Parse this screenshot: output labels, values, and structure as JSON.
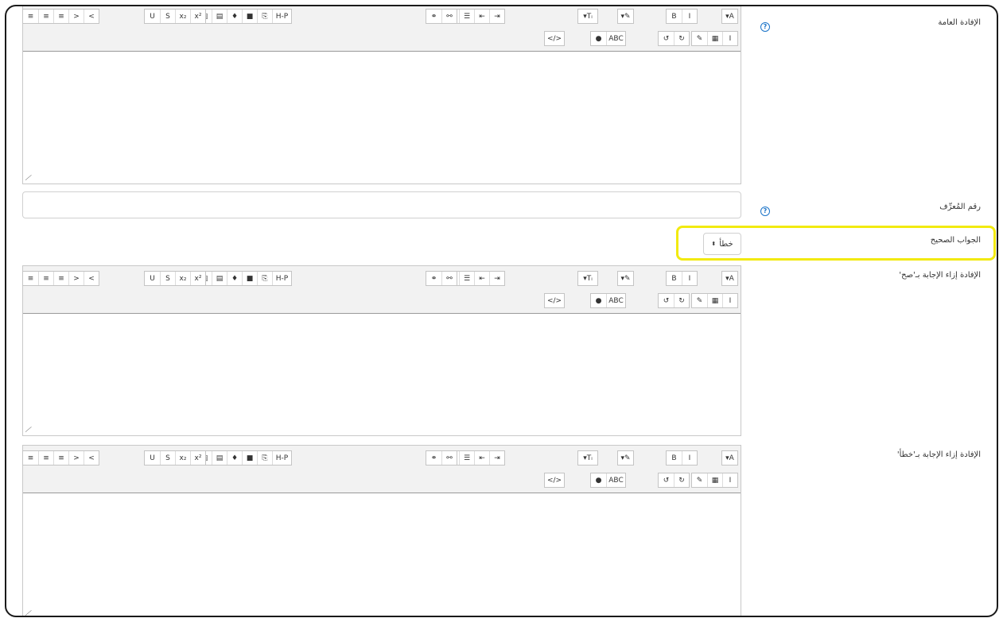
{
  "fields": {
    "general_feedback_label": "الإفادة العامة",
    "id_number_label": "رقم المُعرِّف",
    "correct_answer_label": "الجواب الصحيح",
    "feedback_true_label": "الإفادة إزاء الإجابة بـ'صح'",
    "feedback_false_label": "الإفادة إزاء الإجابة بـ'خطأ'"
  },
  "correct_answer": {
    "selected": "خطأ",
    "arrow": "⬍"
  },
  "help_icon_glyph": "?",
  "toolbar": {
    "row1": [
      {
        "name": "font-color",
        "items": [
          "▾A"
        ]
      },
      {
        "name": "format",
        "items": [
          "B",
          "I"
        ]
      },
      {
        "name": "highlight",
        "items": [
          "▾✎"
        ]
      },
      {
        "name": "font-size",
        "items": [
          "▾Tᵢ"
        ]
      },
      {
        "name": "lists",
        "items": [
          "☷",
          "☰",
          "⇤",
          "⇥"
        ]
      },
      {
        "name": "links",
        "items": [
          "⚭",
          "⚯"
        ]
      },
      {
        "name": "media",
        "items": [
          "☺",
          "▣",
          "▤",
          "♦",
          "■",
          "⎘",
          "H-P"
        ]
      },
      {
        "name": "text-style",
        "items": [
          "U",
          "S",
          "x₂",
          "x²"
        ]
      },
      {
        "name": "align",
        "items": [
          "≡",
          "≡",
          "≡",
          ">",
          "<"
        ]
      }
    ],
    "row2": [
      {
        "name": "edit",
        "items": [
          "✎",
          "▦",
          "Ⅰ"
        ]
      },
      {
        "name": "undo",
        "items": [
          "↺",
          "↻"
        ]
      },
      {
        "name": "access",
        "items": [
          "●",
          "ABC"
        ]
      },
      {
        "name": "html",
        "items": [
          "</>"
        ]
      }
    ]
  },
  "resize_glyph": "⟍"
}
